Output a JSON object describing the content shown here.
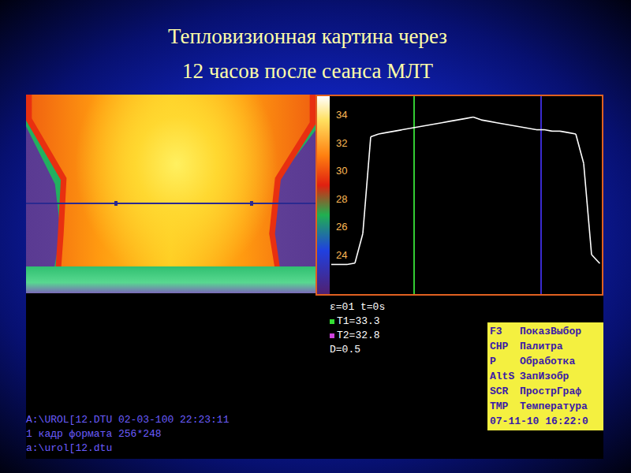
{
  "slide": {
    "title": [
      "Тепловизионная картина через",
      "12 часов после сеанса МЛТ"
    ]
  },
  "profile_chart": {
    "y_ticks": [
      "34",
      "32",
      "30",
      "28",
      "26",
      "24"
    ],
    "series": [
      {
        "name": "temperature",
        "values": [
          23.3,
          23.3,
          23.3,
          23.4,
          25.5,
          32.4,
          32.6,
          32.7,
          32.8,
          32.9,
          33.0,
          33.1,
          33.2,
          33.3,
          33.4,
          33.5,
          33.6,
          33.7,
          33.8,
          33.6,
          33.5,
          33.4,
          33.3,
          33.2,
          33.1,
          33.0,
          32.9,
          32.9,
          32.8,
          32.8,
          32.7,
          32.6,
          30.5,
          24.0,
          23.4
        ]
      }
    ],
    "cursors": [
      {
        "index": 10.5,
        "color": "#33cc33"
      },
      {
        "index": 26.6,
        "color": "#3a2ad0"
      }
    ]
  },
  "readings": [
    {
      "kind": "plain",
      "text": "ε=01 t=0s"
    },
    {
      "kind": "marker",
      "text": "T1=33.3",
      "color": "#33dd33"
    },
    {
      "kind": "marker",
      "text": "T2=32.8",
      "color": "#cc44dd"
    },
    {
      "kind": "plain",
      "text": "D=0.5"
    }
  ],
  "menu": {
    "items": [
      {
        "key": "F3",
        "label": "ПоказВыбор"
      },
      {
        "key": "CHP",
        "label": "Палитра"
      },
      {
        "key": "P",
        "label": "Обработка"
      },
      {
        "key": "AltS",
        "label": "ЗапИзобр"
      },
      {
        "key": "SCR",
        "label": "ПрострГраф"
      },
      {
        "key": "TMP",
        "label": "Температура"
      }
    ],
    "status": "07-11-10 16:22:0"
  },
  "file_info": [
    "A:\\UROL[12.DTU 02-03-100 22:23:11",
    "1 кадр формата 256*248",
    "a:\\urol[12.dtu"
  ]
}
